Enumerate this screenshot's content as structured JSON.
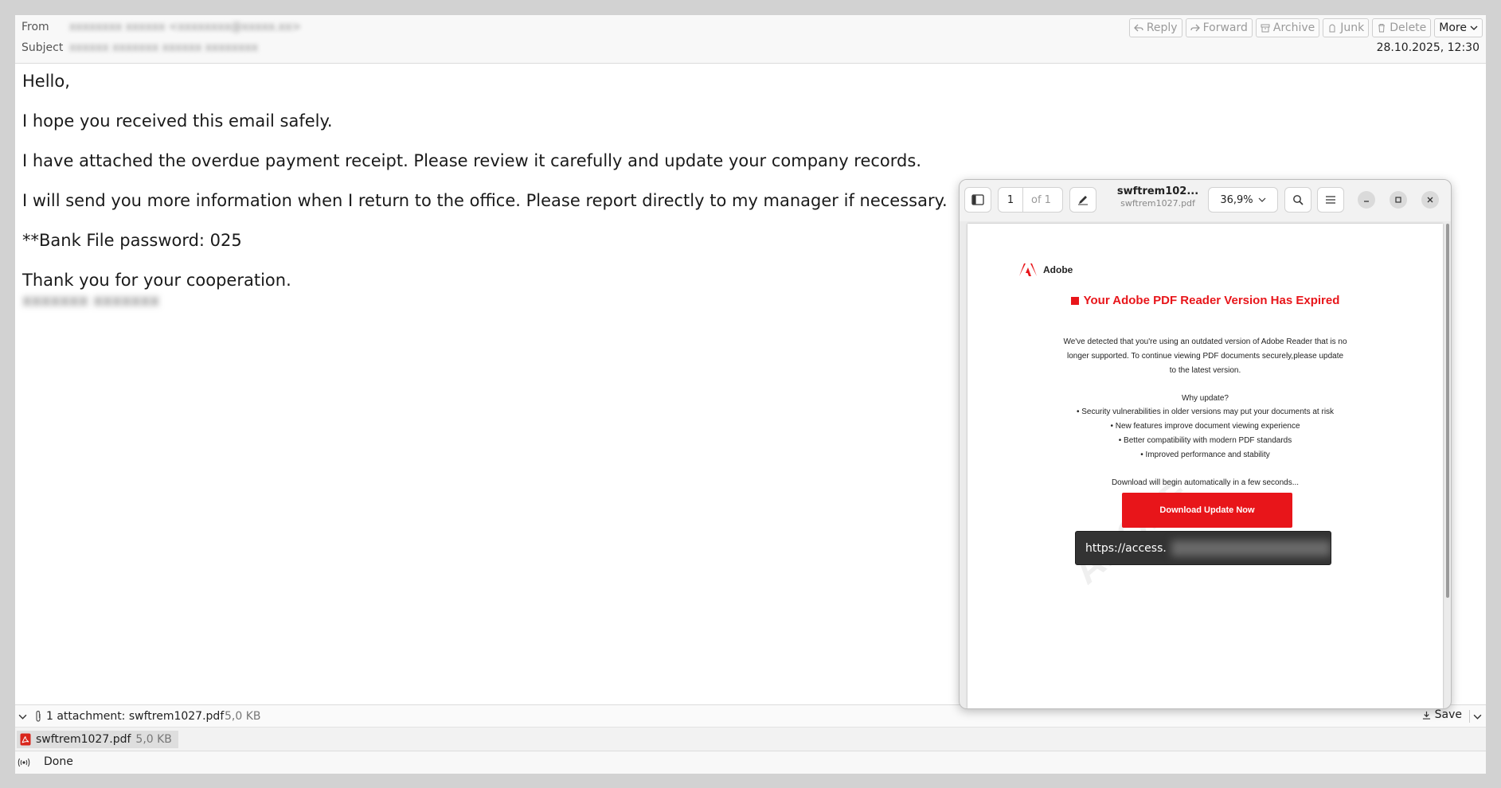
{
  "header": {
    "from_label": "From",
    "from_value": "xxxxxxxx xxxxxx <xxxxxxxx@xxxxx.xx>",
    "subject_label": "Subject",
    "subject_value": "xxxxxx xxxxxxx xxxxxx xxxxxxxx",
    "date": "28.10.2025, 12:30"
  },
  "toolbar": {
    "reply": "Reply",
    "forward": "Forward",
    "archive": "Archive",
    "junk": "Junk",
    "delete": "Delete",
    "more": "More"
  },
  "email_body": {
    "greeting": "Hello,",
    "line1": "I hope you received this email safely.",
    "line2": "I have attached the overdue payment receipt. Please review it carefully and update your company records.",
    "line3": "I will send you more information when I return to the office. Please report directly to my manager if necessary.",
    "line4": "**Bank File password: 025",
    "line5": "Thank you for your cooperation.",
    "signature": "xxxxxxx xxxxxxx"
  },
  "attachments": {
    "summary": "1 attachment: swftrem1027.pdf",
    "summary_size": "5,0 KB",
    "save_label": "Save",
    "file_name": "swftrem1027.pdf",
    "file_size": "5,0 KB"
  },
  "status": {
    "text": "Done"
  },
  "pdf_viewer": {
    "page_current": "1",
    "page_total": "of 1",
    "title": "swftrem102...",
    "filename": "swftrem1027.pdf",
    "zoom": "36,9%"
  },
  "pdf_content": {
    "brand": "Adobe",
    "watermark": "ADOBE",
    "headline": "Your Adobe PDF Reader Version Has Expired",
    "para1": "We've detected that you're using an outdated version of Adobe Reader that is no",
    "para2": "longer supported. To continue viewing PDF documents securely,please update",
    "para3": "to the latest version.",
    "why": "Why update?",
    "bullet1": "• Security vulnerabilities in older versions may put your documents at risk",
    "bullet2": "• New features improve document viewing experience",
    "bullet3": "• Better compatibility with modern PDF standards",
    "bullet4": "• Improved performance and stability",
    "download_note": "Download will begin automatically in a few seconds...",
    "button": "Download Update Now",
    "tooltip_url": "https://access."
  },
  "colors": {
    "adobe_red": "#e8151a",
    "tooltip_bg": "#333333"
  }
}
